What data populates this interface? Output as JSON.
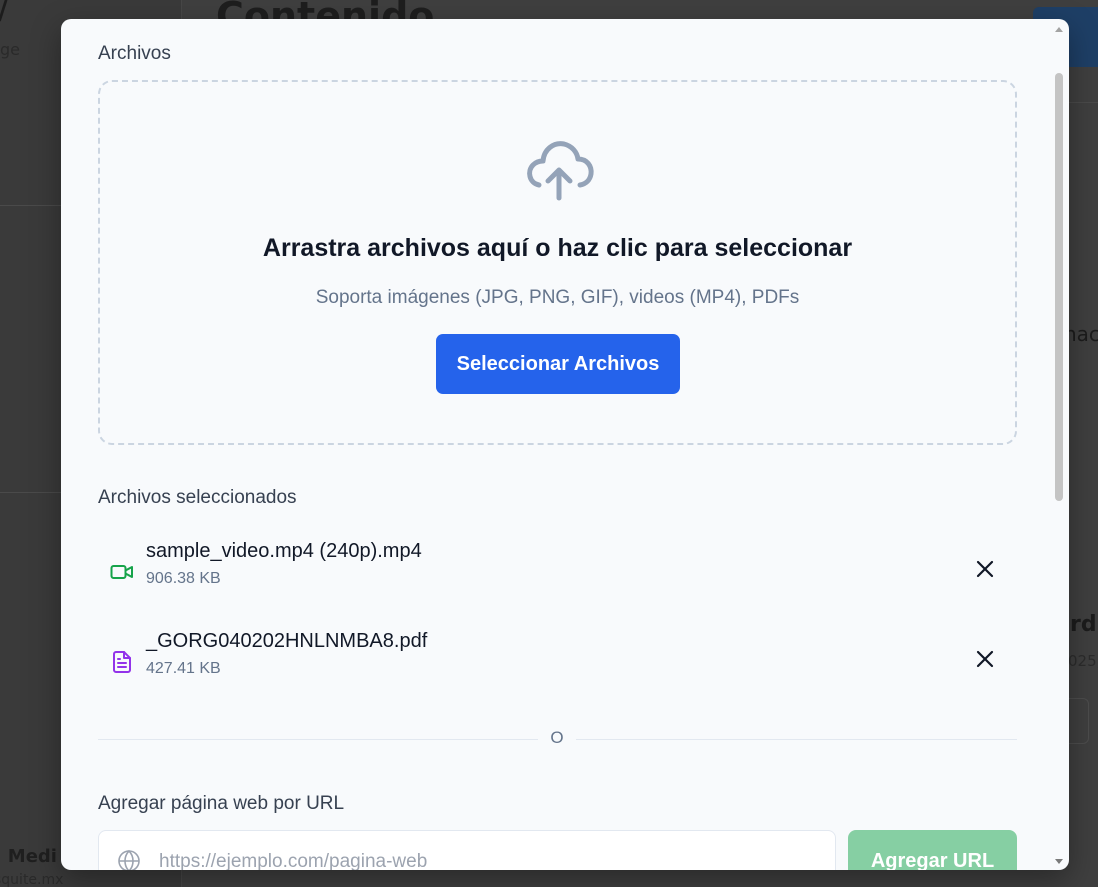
{
  "background": {
    "sidebar_title_partial": "/",
    "sidebar_sub_partial": "ge",
    "sidebar_footer_name_partial": "' Medi",
    "sidebar_footer_sub_partial": "squite.mx",
    "page_title_partial": "Contenido",
    "right_text_1_partial": "nac",
    "right_text_2_partial": "rd",
    "right_text_3_partial": "025,"
  },
  "modal": {
    "files_section_label": "Archivos",
    "dropzone": {
      "icon": "cloud-upload-icon",
      "title": "Arrastra archivos aquí o haz clic para seleccionar",
      "subtitle": "Soporta imágenes (JPG, PNG, GIF), videos (MP4), PDFs",
      "button_label": "Seleccionar Archivos"
    },
    "selected_label": "Archivos seleccionados",
    "files": [
      {
        "name": "sample_video.mp4 (240p).mp4",
        "size": "906.38 KB",
        "icon": "video-icon",
        "icon_color": "#16a34a"
      },
      {
        "name": "_GORG040202HNLNMBA8.pdf",
        "size": "427.41 KB",
        "icon": "document-icon",
        "icon_color": "#9333ea"
      }
    ],
    "divider_text": "O",
    "url_section_label": "Agregar página web por URL",
    "url_input": {
      "placeholder": "https://ejemplo.com/pagina-web",
      "value": ""
    },
    "url_button_label": "Agregar URL"
  },
  "colors": {
    "primary": "#2563eb",
    "success_disabled": "#86cfa3",
    "muted_text": "#64748b",
    "dropzone_border": "#cbd5e1"
  }
}
